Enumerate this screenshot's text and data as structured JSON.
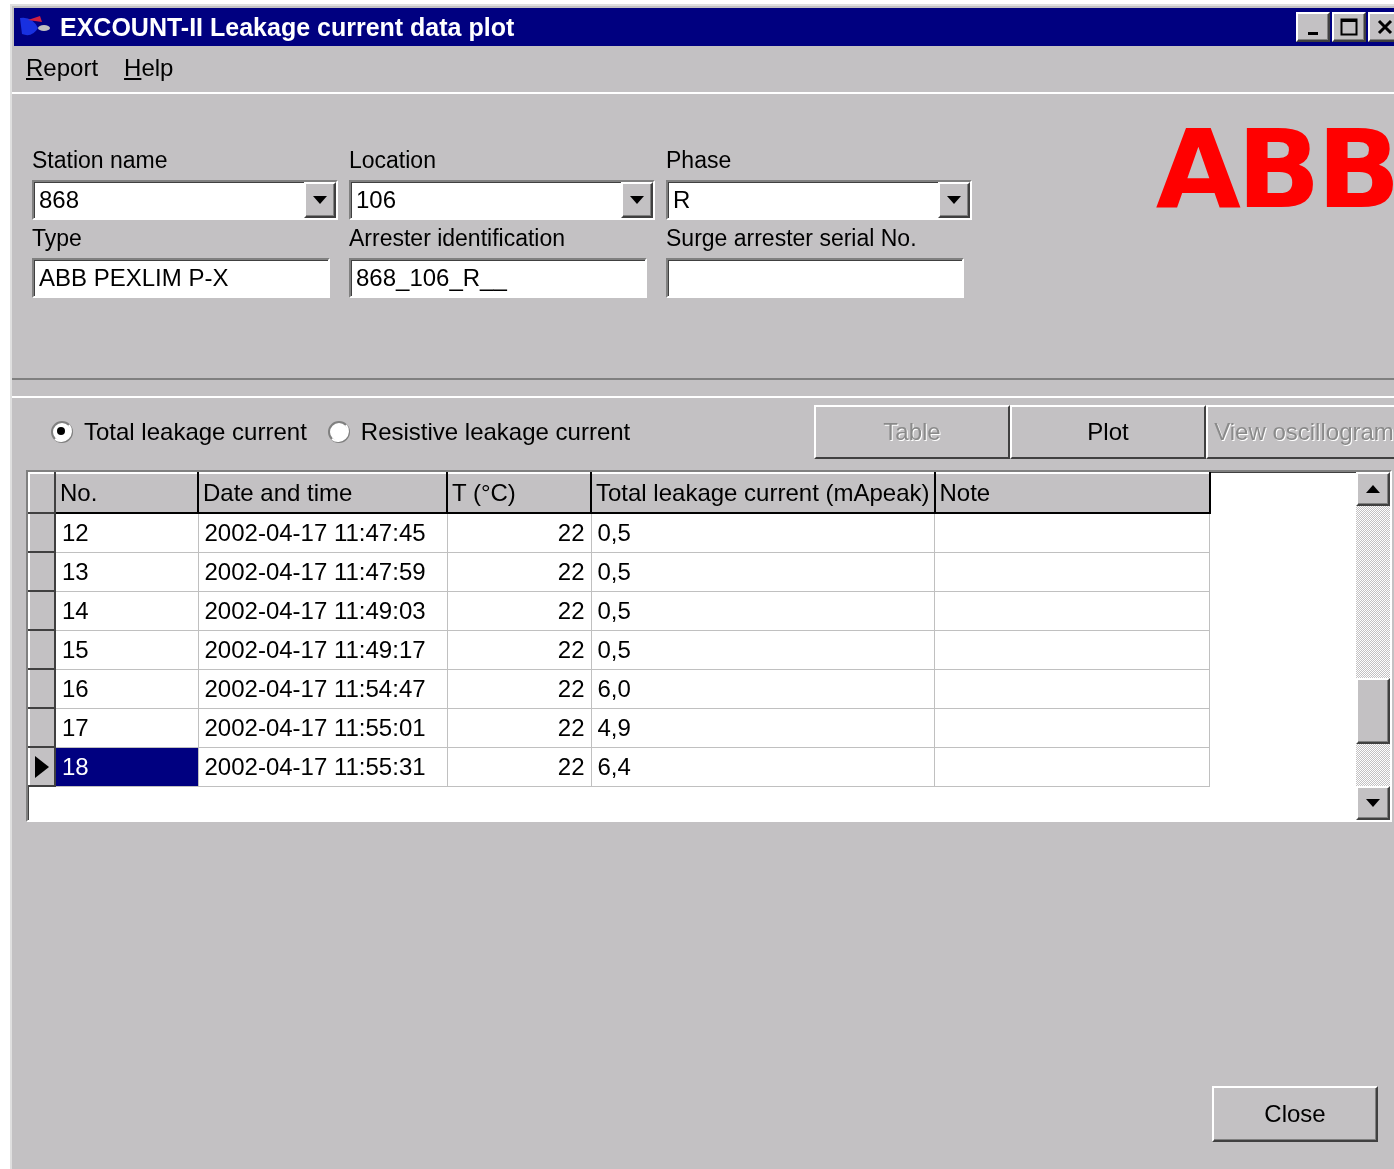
{
  "window": {
    "title": "EXCOUNT-II Leakage current data plot"
  },
  "menu": [
    "Report",
    "Help"
  ],
  "logo": "ABB",
  "fields": [
    {
      "label": "Station name",
      "value": "868",
      "kind": "combo"
    },
    {
      "label": "Location",
      "value": "106",
      "kind": "combo"
    },
    {
      "label": "Phase",
      "value": "R",
      "kind": "combo"
    },
    {
      "label": "Type",
      "value": "ABB PEXLIM P-X",
      "kind": "text"
    },
    {
      "label": "Arrester identification",
      "value": "868_106_R__",
      "kind": "text"
    },
    {
      "label": "Surge arrester serial No.",
      "kind": "text"
    }
  ],
  "radios": [
    {
      "label": "Total leakage current",
      "selected": true
    },
    {
      "label": "Resistive leakage current",
      "selected": false
    }
  ],
  "view_buttons": [
    {
      "label": "Table",
      "disabled": true
    },
    {
      "label": "Plot",
      "disabled": false
    },
    {
      "label": "View oscillogram",
      "disabled": true
    }
  ],
  "table": {
    "columns": [
      "No.",
      "Date and time",
      "T (°C)",
      "Total leakage current (mApeak)",
      "Note"
    ],
    "rows": [
      {
        "no": "12",
        "datetime": "2002-04-17 11:47:45",
        "t": "22",
        "current": "0,5",
        "selected": false
      },
      {
        "no": "13",
        "datetime": "2002-04-17 11:47:59",
        "t": "22",
        "current": "0,5",
        "selected": false
      },
      {
        "no": "14",
        "datetime": "2002-04-17 11:49:03",
        "t": "22",
        "current": "0,5",
        "selected": false
      },
      {
        "no": "15",
        "datetime": "2002-04-17 11:49:17",
        "t": "22",
        "current": "0,5",
        "selected": false
      },
      {
        "no": "16",
        "datetime": "2002-04-17 11:54:47",
        "t": "22",
        "current": "6,0",
        "selected": false
      },
      {
        "no": "17",
        "datetime": "2002-04-17 11:55:01",
        "t": "22",
        "current": "4,9",
        "selected": false
      },
      {
        "no": "18",
        "datetime": "2002-04-17 11:55:31",
        "t": "22",
        "current": "6,4",
        "selected": true
      }
    ]
  },
  "close_button": "Close"
}
